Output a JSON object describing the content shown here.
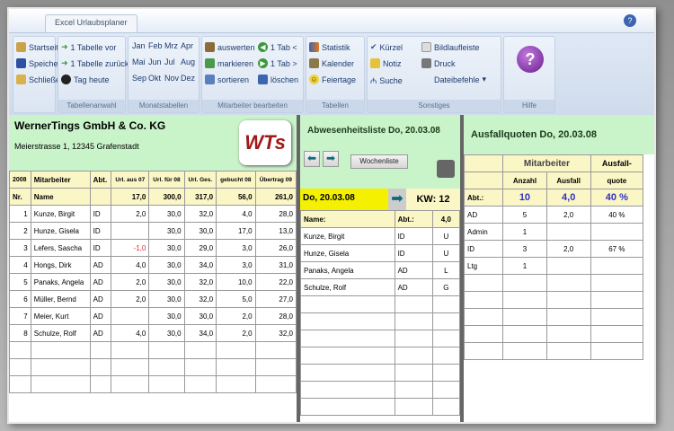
{
  "tab": "Excel Urlaubsplaner",
  "ribbon": {
    "g1": {
      "items": [
        "Startseite",
        "Speichern",
        "Schließen"
      ]
    },
    "g2": {
      "items": [
        "1 Tabelle vor",
        "1 Tabelle zurück",
        "Tag heute"
      ],
      "label": "Tabellenanwahl"
    },
    "g3": {
      "months": [
        "Jan",
        "Feb",
        "Mrz",
        "Apr",
        "Mai",
        "Jun",
        "Jul",
        "Aug",
        "Sep",
        "Okt",
        "Nov",
        "Dez"
      ],
      "label": "Monatstabellen"
    },
    "g4": {
      "items": [
        "auswerten",
        "markieren",
        "sortieren",
        "1 Tab <",
        "1 Tab >",
        "löschen"
      ],
      "label": "Mitarbeiter bearbeiten"
    },
    "g5": {
      "items": [
        "Statistik",
        "Kalender",
        "Feiertage"
      ],
      "label": "Tabellen"
    },
    "g6": {
      "items": [
        "Kürzel",
        "Notiz",
        "Suche",
        "Bildlaufleiste",
        "Druck",
        "Dateibefehle"
      ],
      "label": "Sonstiges"
    },
    "g7": {
      "label": "Hilfe"
    }
  },
  "left": {
    "company": "WernerTings GmbH & Co. KG",
    "address": "Meierstrasse 1, 12345 Grafenstadt",
    "logo": "WTS",
    "year": "2008",
    "headers": [
      "Nr.",
      "Mitarbeiter",
      "Name",
      "Abt.",
      "Url. aus 07",
      "Url. für 08",
      "Url. Ges.",
      "gebucht 08",
      "Übertrag 09"
    ],
    "totals": [
      "17,0",
      "300,0",
      "317,0",
      "56,0",
      "261,0"
    ],
    "rows": [
      [
        "1",
        "Kunze, Birgit",
        "ID",
        "2,0",
        "30,0",
        "32,0",
        "4,0",
        "28,0"
      ],
      [
        "2",
        "Hunze, Gisela",
        "ID",
        "",
        "30,0",
        "30,0",
        "17,0",
        "13,0"
      ],
      [
        "3",
        "Lefers, Sascha",
        "ID",
        "-1,0",
        "30,0",
        "29,0",
        "3,0",
        "26,0"
      ],
      [
        "4",
        "Hongs, Dirk",
        "AD",
        "4,0",
        "30,0",
        "34,0",
        "3,0",
        "31,0"
      ],
      [
        "5",
        "Panaks, Angela",
        "AD",
        "2,0",
        "30,0",
        "32,0",
        "10,0",
        "22,0"
      ],
      [
        "6",
        "Müller, Bernd",
        "AD",
        "2,0",
        "30,0",
        "32,0",
        "5,0",
        "27,0"
      ],
      [
        "7",
        "Meier, Kurt",
        "AD",
        "",
        "30,0",
        "30,0",
        "2,0",
        "28,0"
      ],
      [
        "8",
        "Schulze, Rolf",
        "AD",
        "4,0",
        "30,0",
        "34,0",
        "2,0",
        "32,0"
      ]
    ]
  },
  "middle": {
    "title": "Abwesenheitsliste Do, 20.03.08",
    "week_button": "Wochenliste",
    "date": "Do, 20.03.08",
    "kw": "KW: 12",
    "headers": [
      "Name:",
      "Abt.:",
      "4,0"
    ],
    "rows": [
      [
        "Kunze, Birgit",
        "ID",
        "U"
      ],
      [
        "Hunze, Gisela",
        "ID",
        "U"
      ],
      [
        "Panaks, Angela",
        "AD",
        "L"
      ],
      [
        "Schulze, Rolf",
        "AD",
        "G"
      ]
    ]
  },
  "right": {
    "title": "Ausfallquoten Do, 20.03.08",
    "group": "Mitarbeiter",
    "headers": [
      "Abt.:",
      "Anzahl",
      "Ausfall",
      "Ausfall-",
      "quote"
    ],
    "totals": [
      "10",
      "4,0",
      "40 %"
    ],
    "rows": [
      [
        "AD",
        "5",
        "2,0",
        "40 %"
      ],
      [
        "Admin",
        "1",
        "",
        ""
      ],
      [
        "ID",
        "3",
        "2,0",
        "67 %"
      ],
      [
        "Ltg",
        "1",
        "",
        ""
      ]
    ]
  }
}
